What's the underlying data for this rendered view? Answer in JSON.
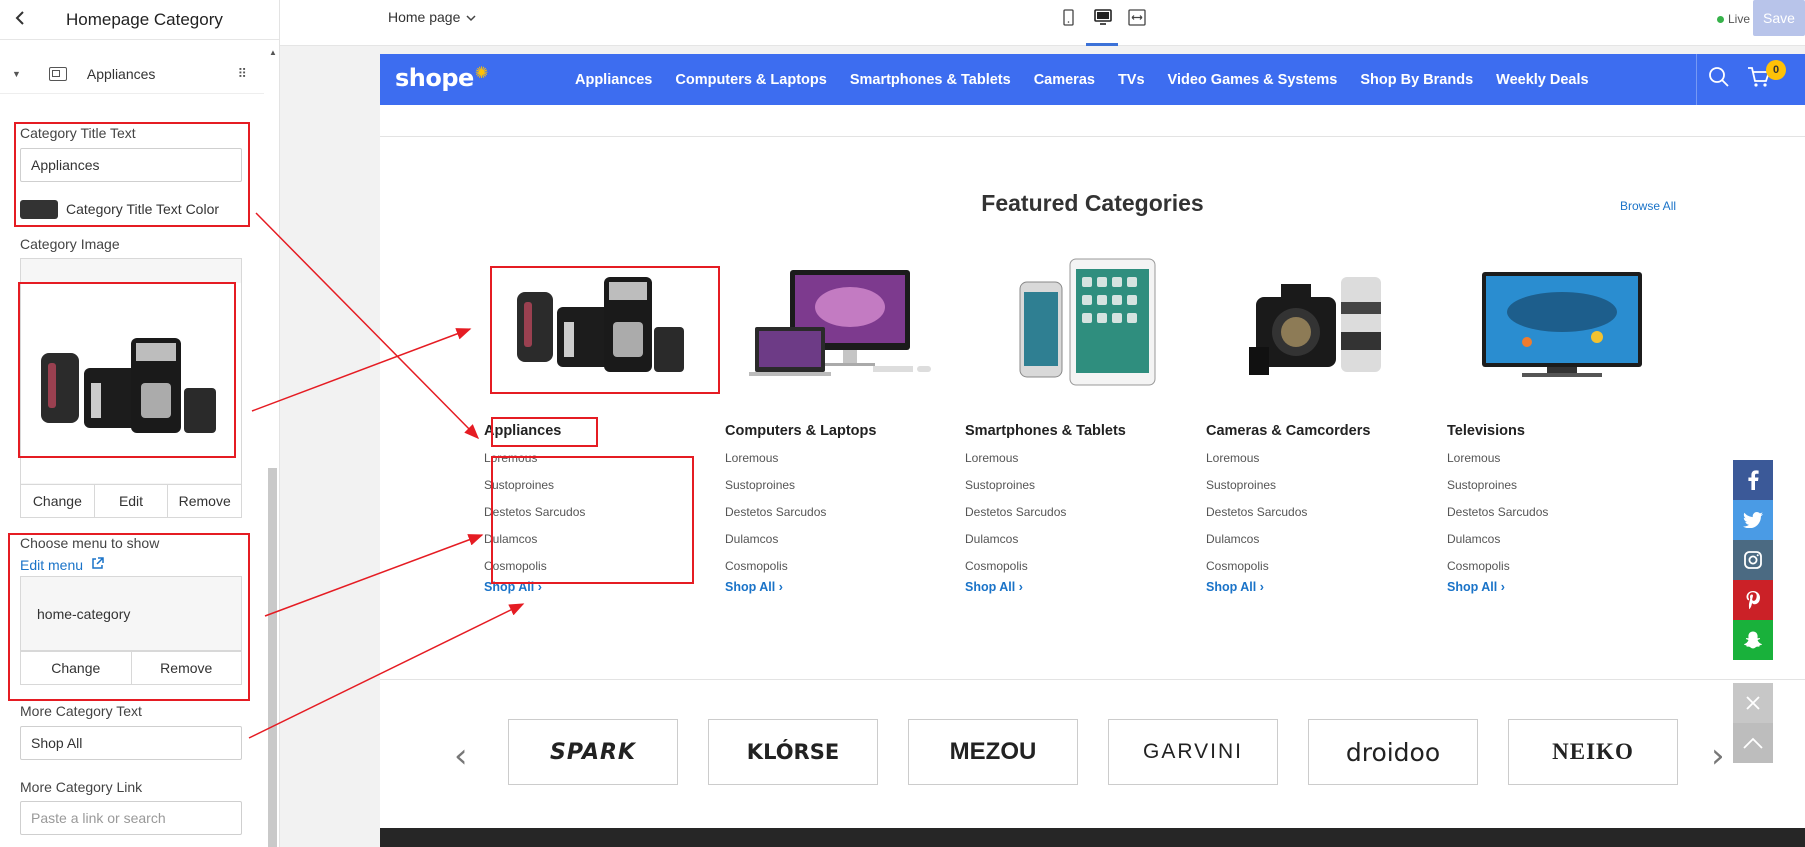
{
  "sidebar": {
    "title": "Homepage Category",
    "section_label": "Appliances",
    "category_title_label": "Category Title Text",
    "category_title_value": "Appliances",
    "title_color_label": "Category Title Text Color",
    "title_color": "#333333",
    "category_image_label": "Category Image",
    "image_buttons": [
      "Change",
      "Edit",
      "Remove"
    ],
    "menu_label": "Choose menu to show",
    "edit_menu_link": "Edit menu",
    "menu_value": "home-category",
    "menu_buttons": [
      "Change",
      "Remove"
    ],
    "more_text_label": "More Category Text",
    "more_text_value": "Shop All",
    "more_link_label": "More Category Link",
    "more_link_placeholder": "Paste a link or search"
  },
  "topbar": {
    "page_select": "Home page",
    "status": "Live",
    "save_label": "Save",
    "colors": {
      "live_dot": "#36b24a",
      "active_device": "#3c72d8"
    }
  },
  "shop": {
    "logo": "shope",
    "nav_items": [
      "Appliances",
      "Computers & Laptops",
      "Smartphones & Tablets",
      "Cameras",
      "TVs",
      "Video Games & Systems",
      "Shop By Brands",
      "Weekly Deals"
    ],
    "cart_count": "0",
    "accent_color": "#3d6df0",
    "featured_title": "Featured Categories",
    "browse_all": "Browse All",
    "categories": [
      {
        "name": "Appliances",
        "image": "kitchen-appliances-image",
        "links": [
          "Loremous",
          "Sustoproines",
          "Destetos Sarcudos",
          "Dulamcos",
          "Cosmopolis"
        ],
        "shop_all": "Shop All"
      },
      {
        "name": "Computers & Laptops",
        "image": "computers-image",
        "links": [
          "Loremous",
          "Sustoproines",
          "Destetos Sarcudos",
          "Dulamcos",
          "Cosmopolis"
        ],
        "shop_all": "Shop All"
      },
      {
        "name": "Smartphones & Tablets",
        "image": "phones-tablets-image",
        "links": [
          "Loremous",
          "Sustoproines",
          "Destetos Sarcudos",
          "Dulamcos",
          "Cosmopolis"
        ],
        "shop_all": "Shop All"
      },
      {
        "name": "Cameras & Camcorders",
        "image": "camera-image",
        "links": [
          "Loremous",
          "Sustoproines",
          "Destetos Sarcudos",
          "Dulamcos",
          "Cosmopolis"
        ],
        "shop_all": "Shop All"
      },
      {
        "name": "Televisions",
        "image": "television-image",
        "links": [
          "Loremous",
          "Sustoproines",
          "Destetos Sarcudos",
          "Dulamcos",
          "Cosmopolis"
        ],
        "shop_all": "Shop All"
      }
    ],
    "brands": [
      "SPARK",
      "KLÓRSE",
      "MEZOU",
      "GARVINI",
      "droidoo",
      "NEIKO"
    ],
    "social": [
      {
        "icon": "facebook-icon",
        "color": "#3b5998"
      },
      {
        "icon": "twitter-icon",
        "color": "#4a9be5"
      },
      {
        "icon": "instagram-icon",
        "color": "#4b6a82"
      },
      {
        "icon": "pinterest-icon",
        "color": "#cb2127"
      },
      {
        "icon": "snapchat-icon",
        "color": "#19b13b"
      }
    ]
  }
}
